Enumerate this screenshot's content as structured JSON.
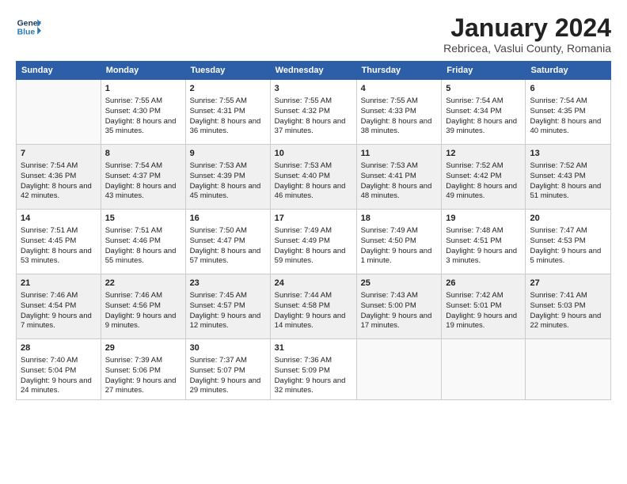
{
  "header": {
    "logo_line1": "General",
    "logo_line2": "Blue",
    "title": "January 2024",
    "subtitle": "Rebricea, Vaslui County, Romania"
  },
  "days_header": [
    "Sunday",
    "Monday",
    "Tuesday",
    "Wednesday",
    "Thursday",
    "Friday",
    "Saturday"
  ],
  "weeks": [
    [
      {
        "day": "",
        "sunrise": "",
        "sunset": "",
        "daylight": "",
        "empty": true
      },
      {
        "day": "1",
        "sunrise": "Sunrise: 7:55 AM",
        "sunset": "Sunset: 4:30 PM",
        "daylight": "Daylight: 8 hours and 35 minutes."
      },
      {
        "day": "2",
        "sunrise": "Sunrise: 7:55 AM",
        "sunset": "Sunset: 4:31 PM",
        "daylight": "Daylight: 8 hours and 36 minutes."
      },
      {
        "day": "3",
        "sunrise": "Sunrise: 7:55 AM",
        "sunset": "Sunset: 4:32 PM",
        "daylight": "Daylight: 8 hours and 37 minutes."
      },
      {
        "day": "4",
        "sunrise": "Sunrise: 7:55 AM",
        "sunset": "Sunset: 4:33 PM",
        "daylight": "Daylight: 8 hours and 38 minutes."
      },
      {
        "day": "5",
        "sunrise": "Sunrise: 7:54 AM",
        "sunset": "Sunset: 4:34 PM",
        "daylight": "Daylight: 8 hours and 39 minutes."
      },
      {
        "day": "6",
        "sunrise": "Sunrise: 7:54 AM",
        "sunset": "Sunset: 4:35 PM",
        "daylight": "Daylight: 8 hours and 40 minutes."
      }
    ],
    [
      {
        "day": "7",
        "sunrise": "Sunrise: 7:54 AM",
        "sunset": "Sunset: 4:36 PM",
        "daylight": "Daylight: 8 hours and 42 minutes."
      },
      {
        "day": "8",
        "sunrise": "Sunrise: 7:54 AM",
        "sunset": "Sunset: 4:37 PM",
        "daylight": "Daylight: 8 hours and 43 minutes."
      },
      {
        "day": "9",
        "sunrise": "Sunrise: 7:53 AM",
        "sunset": "Sunset: 4:39 PM",
        "daylight": "Daylight: 8 hours and 45 minutes."
      },
      {
        "day": "10",
        "sunrise": "Sunrise: 7:53 AM",
        "sunset": "Sunset: 4:40 PM",
        "daylight": "Daylight: 8 hours and 46 minutes."
      },
      {
        "day": "11",
        "sunrise": "Sunrise: 7:53 AM",
        "sunset": "Sunset: 4:41 PM",
        "daylight": "Daylight: 8 hours and 48 minutes."
      },
      {
        "day": "12",
        "sunrise": "Sunrise: 7:52 AM",
        "sunset": "Sunset: 4:42 PM",
        "daylight": "Daylight: 8 hours and 49 minutes."
      },
      {
        "day": "13",
        "sunrise": "Sunrise: 7:52 AM",
        "sunset": "Sunset: 4:43 PM",
        "daylight": "Daylight: 8 hours and 51 minutes."
      }
    ],
    [
      {
        "day": "14",
        "sunrise": "Sunrise: 7:51 AM",
        "sunset": "Sunset: 4:45 PM",
        "daylight": "Daylight: 8 hours and 53 minutes."
      },
      {
        "day": "15",
        "sunrise": "Sunrise: 7:51 AM",
        "sunset": "Sunset: 4:46 PM",
        "daylight": "Daylight: 8 hours and 55 minutes."
      },
      {
        "day": "16",
        "sunrise": "Sunrise: 7:50 AM",
        "sunset": "Sunset: 4:47 PM",
        "daylight": "Daylight: 8 hours and 57 minutes."
      },
      {
        "day": "17",
        "sunrise": "Sunrise: 7:49 AM",
        "sunset": "Sunset: 4:49 PM",
        "daylight": "Daylight: 8 hours and 59 minutes."
      },
      {
        "day": "18",
        "sunrise": "Sunrise: 7:49 AM",
        "sunset": "Sunset: 4:50 PM",
        "daylight": "Daylight: 9 hours and 1 minute."
      },
      {
        "day": "19",
        "sunrise": "Sunrise: 7:48 AM",
        "sunset": "Sunset: 4:51 PM",
        "daylight": "Daylight: 9 hours and 3 minutes."
      },
      {
        "day": "20",
        "sunrise": "Sunrise: 7:47 AM",
        "sunset": "Sunset: 4:53 PM",
        "daylight": "Daylight: 9 hours and 5 minutes."
      }
    ],
    [
      {
        "day": "21",
        "sunrise": "Sunrise: 7:46 AM",
        "sunset": "Sunset: 4:54 PM",
        "daylight": "Daylight: 9 hours and 7 minutes."
      },
      {
        "day": "22",
        "sunrise": "Sunrise: 7:46 AM",
        "sunset": "Sunset: 4:56 PM",
        "daylight": "Daylight: 9 hours and 9 minutes."
      },
      {
        "day": "23",
        "sunrise": "Sunrise: 7:45 AM",
        "sunset": "Sunset: 4:57 PM",
        "daylight": "Daylight: 9 hours and 12 minutes."
      },
      {
        "day": "24",
        "sunrise": "Sunrise: 7:44 AM",
        "sunset": "Sunset: 4:58 PM",
        "daylight": "Daylight: 9 hours and 14 minutes."
      },
      {
        "day": "25",
        "sunrise": "Sunrise: 7:43 AM",
        "sunset": "Sunset: 5:00 PM",
        "daylight": "Daylight: 9 hours and 17 minutes."
      },
      {
        "day": "26",
        "sunrise": "Sunrise: 7:42 AM",
        "sunset": "Sunset: 5:01 PM",
        "daylight": "Daylight: 9 hours and 19 minutes."
      },
      {
        "day": "27",
        "sunrise": "Sunrise: 7:41 AM",
        "sunset": "Sunset: 5:03 PM",
        "daylight": "Daylight: 9 hours and 22 minutes."
      }
    ],
    [
      {
        "day": "28",
        "sunrise": "Sunrise: 7:40 AM",
        "sunset": "Sunset: 5:04 PM",
        "daylight": "Daylight: 9 hours and 24 minutes."
      },
      {
        "day": "29",
        "sunrise": "Sunrise: 7:39 AM",
        "sunset": "Sunset: 5:06 PM",
        "daylight": "Daylight: 9 hours and 27 minutes."
      },
      {
        "day": "30",
        "sunrise": "Sunrise: 7:37 AM",
        "sunset": "Sunset: 5:07 PM",
        "daylight": "Daylight: 9 hours and 29 minutes."
      },
      {
        "day": "31",
        "sunrise": "Sunrise: 7:36 AM",
        "sunset": "Sunset: 5:09 PM",
        "daylight": "Daylight: 9 hours and 32 minutes."
      },
      {
        "day": "",
        "sunrise": "",
        "sunset": "",
        "daylight": "",
        "empty": true
      },
      {
        "day": "",
        "sunrise": "",
        "sunset": "",
        "daylight": "",
        "empty": true
      },
      {
        "day": "",
        "sunrise": "",
        "sunset": "",
        "daylight": "",
        "empty": true
      }
    ]
  ]
}
